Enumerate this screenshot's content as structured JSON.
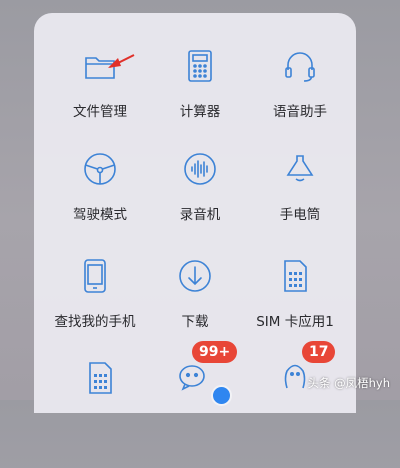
{
  "folder": {
    "apps": [
      {
        "label": "文件管理",
        "icon": "folder-icon"
      },
      {
        "label": "计算器",
        "icon": "calculator-icon"
      },
      {
        "label": "语音助手",
        "icon": "headset-icon"
      },
      {
        "label": "驾驶模式",
        "icon": "steering-wheel-icon"
      },
      {
        "label": "录音机",
        "icon": "sound-wave-icon"
      },
      {
        "label": "手电筒",
        "icon": "flashlight-icon"
      },
      {
        "label": "查找我的手机",
        "icon": "phone-icon"
      },
      {
        "label": "下载",
        "icon": "download-icon"
      },
      {
        "label": "SIM 卡应用1",
        "icon": "sim-card-icon"
      },
      {
        "label": "",
        "icon": "sim-card-icon"
      },
      {
        "label": "",
        "icon": "wechat-icon",
        "badge": "99+"
      },
      {
        "label": "",
        "icon": "qq-icon",
        "badge": "17"
      }
    ]
  },
  "watermark": "头条 @凤梧hyh",
  "colors": {
    "icon_line": "#3d83d6",
    "badge": "#e84637",
    "annotation_arrow": "#e0302a"
  }
}
